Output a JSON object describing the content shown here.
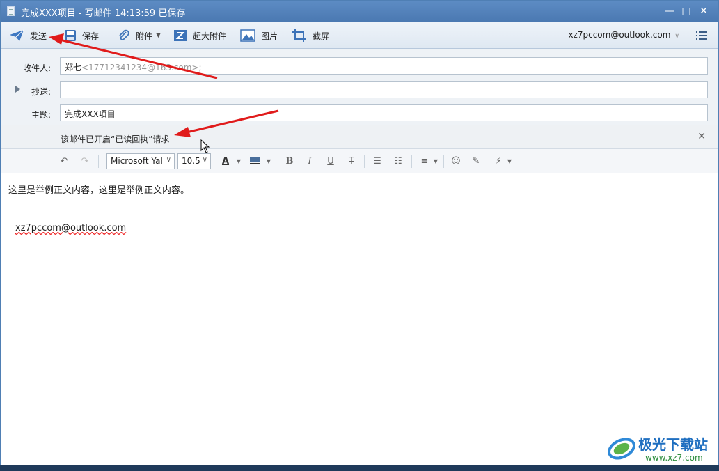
{
  "window": {
    "title": "完成XXX项目 - 写邮件   14:13:59 已保存",
    "minimize": "—",
    "maximize": "□",
    "close": "✕"
  },
  "toolbar": {
    "send": "发送",
    "save": "保存",
    "attach": "附件",
    "large_attach": "超大附件",
    "picture": "图片",
    "screenshot": "截屏",
    "account": "xz7pccom@outlook.com"
  },
  "header": {
    "to_label": "收件人:",
    "to_name": "郑七",
    "to_address": "<17712341234@163.com>;",
    "cc_label": "抄送:",
    "cc_value": "",
    "subject_label": "主题:",
    "subject_value": "完成XXX项目"
  },
  "notice": {
    "text": "该邮件已开启“已读回执”请求",
    "close": "✕"
  },
  "format": {
    "font": "Microsoft Yal",
    "size": "10.5"
  },
  "body": {
    "text": "这里是举例正文内容，这里是举例正文内容。",
    "signature": "xz7pccom@outlook.com"
  },
  "watermark": {
    "name": "极光下载站",
    "url": "www.xz7.com"
  },
  "colors": {
    "titlebar": "#4a78b1",
    "accent": "#1f6fc0",
    "arrow": "#e01b1b"
  }
}
